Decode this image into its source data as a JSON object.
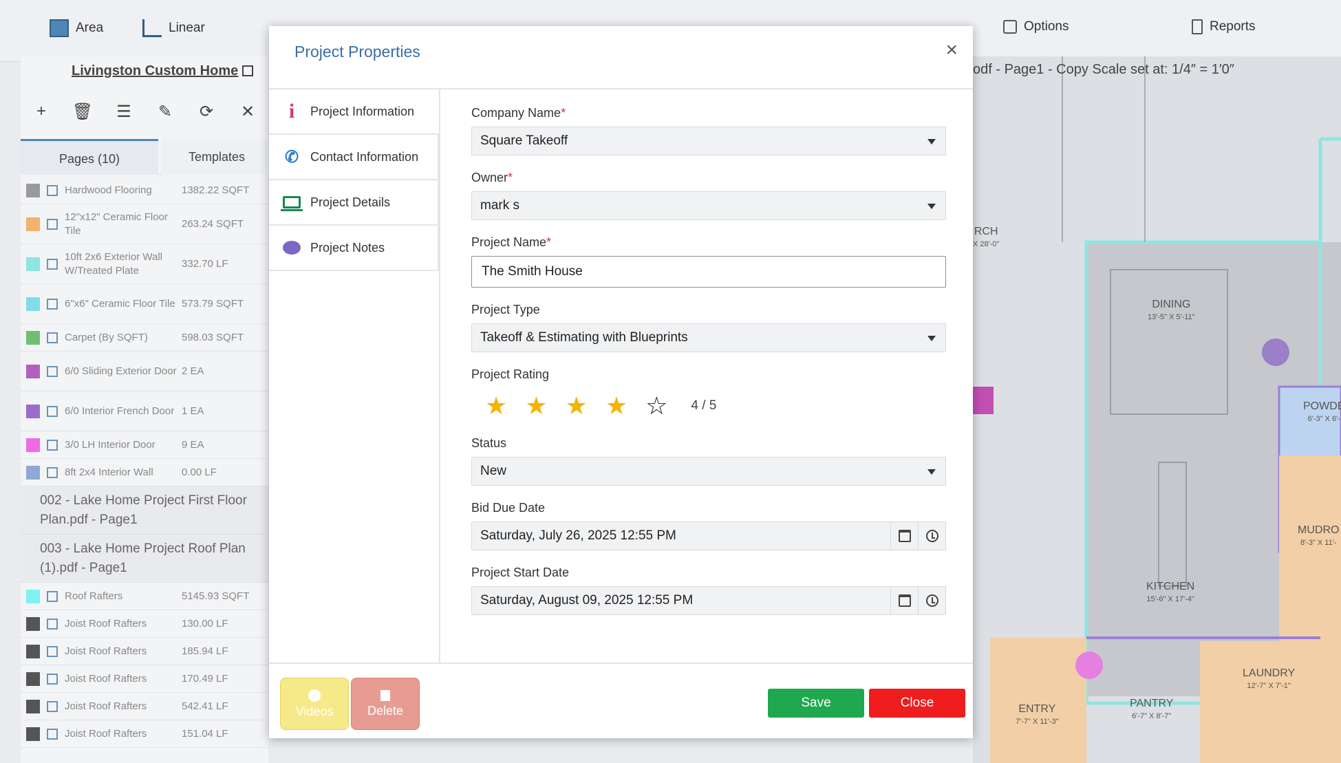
{
  "toolbar": {
    "items": [
      {
        "label": "Area",
        "icon": "area-icon"
      },
      {
        "label": "Linear",
        "icon": "linear-icon"
      },
      {
        "label": "Options",
        "icon": "box-icon"
      },
      {
        "label": "Reports",
        "icon": "document-icon"
      }
    ]
  },
  "left_panel": {
    "project_link": "Livingston Custom Home",
    "tabs": [
      "Pages (10)",
      "Templates"
    ],
    "items": [
      {
        "name": "Hardwood Flooring",
        "value": "1382.22 SQFT",
        "color": "#9a9a9a"
      },
      {
        "name": "12\"x12\" Ceramic Floor Tile",
        "value": "263.24 SQFT",
        "color": "#f2b36b"
      },
      {
        "name": "10ft 2x6 Exterior Wall W/Treated Plate",
        "value": "332.70 LF",
        "color": "#8ee6e0"
      },
      {
        "name": "6\"x6\" Ceramic Floor Tile",
        "value": "573.79 SQFT",
        "color": "#7fdde6"
      },
      {
        "name": "Carpet (By SQFT)",
        "value": "598.03 SQFT",
        "color": "#6fbf73"
      },
      {
        "name": "6/0 Sliding Exterior Door",
        "value": "2 EA",
        "color": "#b25fbf"
      },
      {
        "name": "6/0 Interior French Door",
        "value": "1 EA",
        "color": "#9b6ccc"
      },
      {
        "name": "3/0 LH Interior Door",
        "value": "9 EA",
        "color": "#f06ae8"
      },
      {
        "name": "8ft 2x4 Interior Wall",
        "value": "0.00 LF",
        "color": "#8fa8d6"
      }
    ],
    "groups": [
      "002 - Lake Home Project First Floor Plan.pdf - Page1",
      "003 - Lake Home Project Roof Plan (1).pdf - Page1"
    ],
    "items2": [
      {
        "name": "Roof Rafters",
        "value": "5145.93 SQFT",
        "color": "#7ff2f2"
      },
      {
        "name": "Joist Roof Rafters",
        "value": "130.00 LF",
        "color": "#555555"
      },
      {
        "name": "Joist Roof Rafters",
        "value": "185.94 LF",
        "color": "#555555"
      },
      {
        "name": "Joist Roof Rafters",
        "value": "170.49 LF",
        "color": "#555555"
      },
      {
        "name": "Joist Roof Rafters",
        "value": "542.41 LF",
        "color": "#555555"
      },
      {
        "name": "Joist Roof Rafters",
        "value": "151.04 LF",
        "color": "#555555"
      }
    ]
  },
  "canvas": {
    "scale_text": "odf - Page1 - Copy Scale set at: 1/4″ = 1′0″",
    "rooms": [
      {
        "label": "DINING",
        "sub": "13'-5\" X 5'-11\""
      },
      {
        "label": "KITCHEN",
        "sub": "15'-6\" X 17'-4\""
      },
      {
        "label": "PANTRY",
        "sub": "6'-7\" X 8'-7\""
      },
      {
        "label": "ENTRY",
        "sub": "7'-7\" X 11'-3\""
      },
      {
        "label": "LAUNDRY",
        "sub": "12'-7\" X 7'-1\""
      },
      {
        "label": "MUDRO",
        "sub": "8'-3\" X 11'-"
      },
      {
        "label": "POWDE",
        "sub": "6'-3\" X 6'-"
      },
      {
        "label": "RCH",
        "sub": "X 28'-0\""
      }
    ]
  },
  "modal": {
    "title": "Project Properties",
    "close_symbol": "×",
    "nav": [
      {
        "label": "Project Information"
      },
      {
        "label": "Contact Information"
      },
      {
        "label": "Project Details"
      },
      {
        "label": "Project Notes"
      }
    ],
    "form": {
      "company_name_label": "Company Name",
      "company_name_value": "Square Takeoff",
      "owner_label": "Owner",
      "owner_value": "mark s",
      "project_name_label": "Project Name",
      "project_name_value": "The Smith House",
      "project_type_label": "Project Type",
      "project_type_value": "Takeoff & Estimating with Blueprints",
      "rating_label": "Project Rating",
      "rating_value": 4,
      "rating_max": 5,
      "rating_text": "4 / 5",
      "status_label": "Status",
      "status_value": "New",
      "bid_due_label": "Bid Due Date",
      "bid_due_value": "Saturday, July 26, 2025 12:55 PM",
      "start_date_label": "Project Start Date",
      "start_date_value": "Saturday, August 09, 2025 12:55 PM",
      "required_mark": "*"
    },
    "footer": {
      "videos_label": "Videos",
      "delete_label": "Delete",
      "save_label": "Save",
      "close_label": "Close"
    }
  }
}
